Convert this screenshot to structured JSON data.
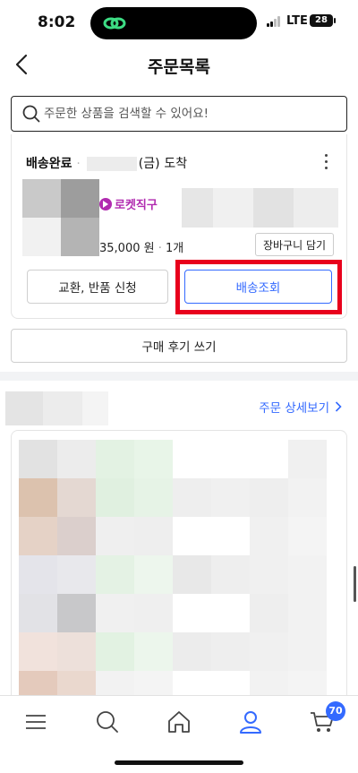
{
  "status_bar": {
    "time": "8:02",
    "network": "LTE",
    "battery": "28"
  },
  "header": {
    "title": "주문목록"
  },
  "search": {
    "placeholder": "주문한 상품을 검색할 수 있어요!"
  },
  "order": {
    "status": "배송완료",
    "separator": "·",
    "arrival_day": "(금)",
    "arrival_text": "도착",
    "badge": "로켓직구",
    "price": "35,000 원",
    "qty_sep": "·",
    "qty": "1개",
    "add_to_cart": "장바구니 담기",
    "exchange_return": "교환, 반품 신청",
    "track_delivery": "배송조회"
  },
  "review_button": "구매 후기 쓰기",
  "next_order": {
    "detail_link": "주문 상세보기"
  },
  "bottom_nav": {
    "cart_badge": "70"
  },
  "colors": {
    "accent_blue": "#346aff",
    "highlight_red": "#e8001c",
    "rocket_purple": "#b12bb0"
  }
}
